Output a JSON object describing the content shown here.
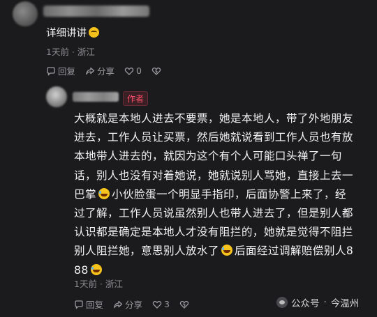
{
  "comment": {
    "text": "详细讲讲",
    "emoji": "grin-face",
    "time": "1天前",
    "location": "浙江",
    "actions": {
      "reply": "回复",
      "share": "分享",
      "like_count": "0"
    }
  },
  "author_reply": {
    "badge": "作者",
    "lines": [
      {
        "a": "大概就是本地人进去不要票，她是本地人，带了外地朋友"
      },
      {
        "a": "进去，工作人员让买票，然后她就说看到工作人员也有放"
      },
      {
        "a": "本地带人进去的，就因为这个有个人可能口头禅了一句"
      },
      {
        "a": "话，别人也没有对着她说，她就说别人骂她，直接上去一"
      },
      {
        "a": "巴掌",
        "emoji": "laughing-tears",
        "b": "小伙脸蛋一个明显手指印，后面协警上来了，经"
      },
      {
        "a": "过了解，工作人员说虽然别人也带人进去了，但是别人都"
      },
      {
        "a": "认识都是确定是本地人才没有阻拦的，她就是觉得不阻拦"
      },
      {
        "a": "别人阻拦她，意思别人放水了",
        "emoji": "laughing-tears",
        "b": "后面经过调解赔偿别人8"
      },
      {
        "a": "88",
        "emoji": "laughing-tears",
        "b": ""
      }
    ],
    "time": "1天前",
    "location": "浙江",
    "actions": {
      "reply": "回复",
      "share": "分享",
      "like_count": "3"
    }
  },
  "watermark": {
    "account_type": "公众号",
    "sep": "·",
    "name": "今温州"
  },
  "colors": {
    "background": "#1b1b1d",
    "author_badge": "#ff4f6a"
  }
}
